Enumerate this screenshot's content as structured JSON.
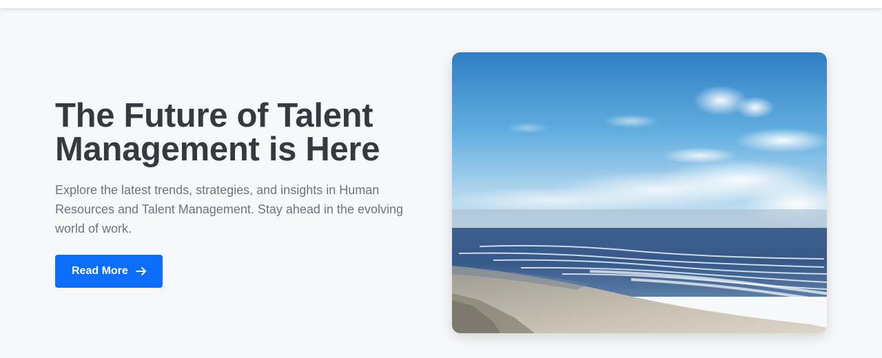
{
  "hero": {
    "title": "The Future of Talent Management is Here",
    "description": "Explore the latest trends, strategies, and insights in Human Resources and Talent Management. Stay ahead in the evolving world of work.",
    "cta_label": "Read More",
    "cta_icon": "arrow-right-icon",
    "image_subject": "beach-ocean-sky-photo"
  },
  "colors": {
    "page_background": "#f7f8fa",
    "title": "#343a40",
    "body_text": "#6c757d",
    "primary": "#0d6efd"
  }
}
